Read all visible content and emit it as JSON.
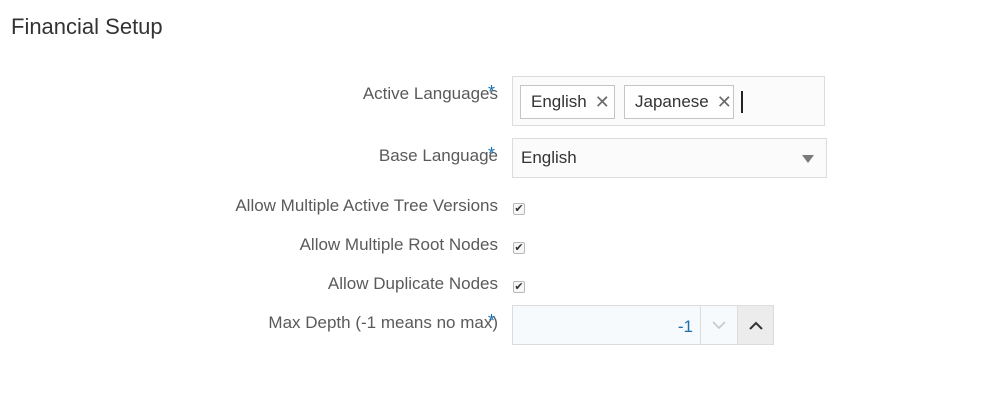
{
  "page": {
    "title": "Financial Setup"
  },
  "form": {
    "active_languages": {
      "label": "Active Languages",
      "required_mark": "*",
      "tags": [
        "English",
        "Japanese"
      ],
      "remove_glyph": "✕"
    },
    "base_language": {
      "label": "Base Language",
      "required_mark": "*",
      "value": "English"
    },
    "allow_multiple_active_tree_versions": {
      "label": "Allow Multiple Active Tree Versions",
      "checked": true,
      "glyph": "✔"
    },
    "allow_multiple_root_nodes": {
      "label": "Allow Multiple Root Nodes",
      "checked": true,
      "glyph": "✔"
    },
    "allow_duplicate_nodes": {
      "label": "Allow Duplicate Nodes",
      "checked": true,
      "glyph": "✔"
    },
    "max_depth": {
      "label": "Max Depth (-1 means no max)",
      "required_mark": "*",
      "value": "-1"
    }
  },
  "colors": {
    "required_accent": "#1a6fb0",
    "label_text": "#5a5a5a"
  },
  "icons": {
    "remove": "close-icon",
    "select_arrow": "caret-down-icon",
    "spin_down": "chevron-down-icon",
    "spin_up": "chevron-up-icon",
    "checkbox_mark": "checkmark-icon"
  }
}
